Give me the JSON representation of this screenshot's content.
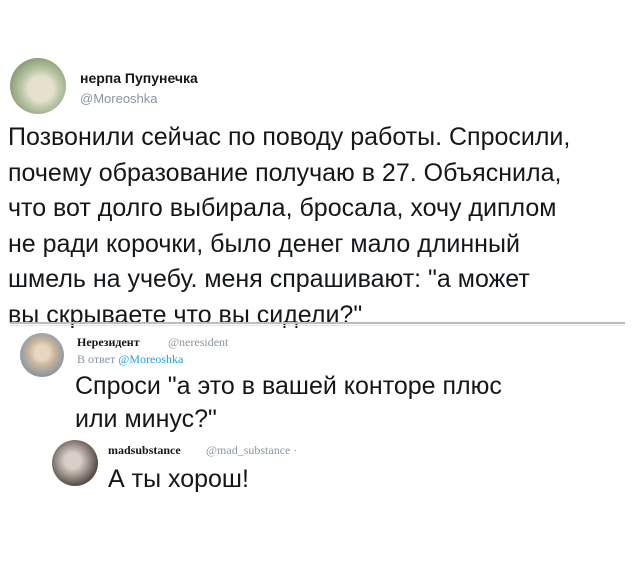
{
  "main_tweet": {
    "author_name": "нерпа Пупунечка",
    "author_handle": "@Moreoshka",
    "text": "Позвонили сейчас по поводу работы. Спросили,\nпочему образование получаю в 27. Объяснила,\nчто вот долго выбирала, бросала, хочу диплом\nне ради корочки, было денег мало длинный\nшмель на учебу. меня спрашивают: \"а может\nвы скрываете что вы сидели?\""
  },
  "reply_1": {
    "author_name": "Нерезидент",
    "author_handle": "@neresident",
    "reply_prefix": "В ответ",
    "reply_to": "@Moreoshka",
    "text": "Спроси \"а это в вашей конторе плюс\nили минус?\""
  },
  "reply_2": {
    "author_name": "madsubstance",
    "author_handle": "@mad_substance ·",
    "text": "А ты хорош!"
  }
}
